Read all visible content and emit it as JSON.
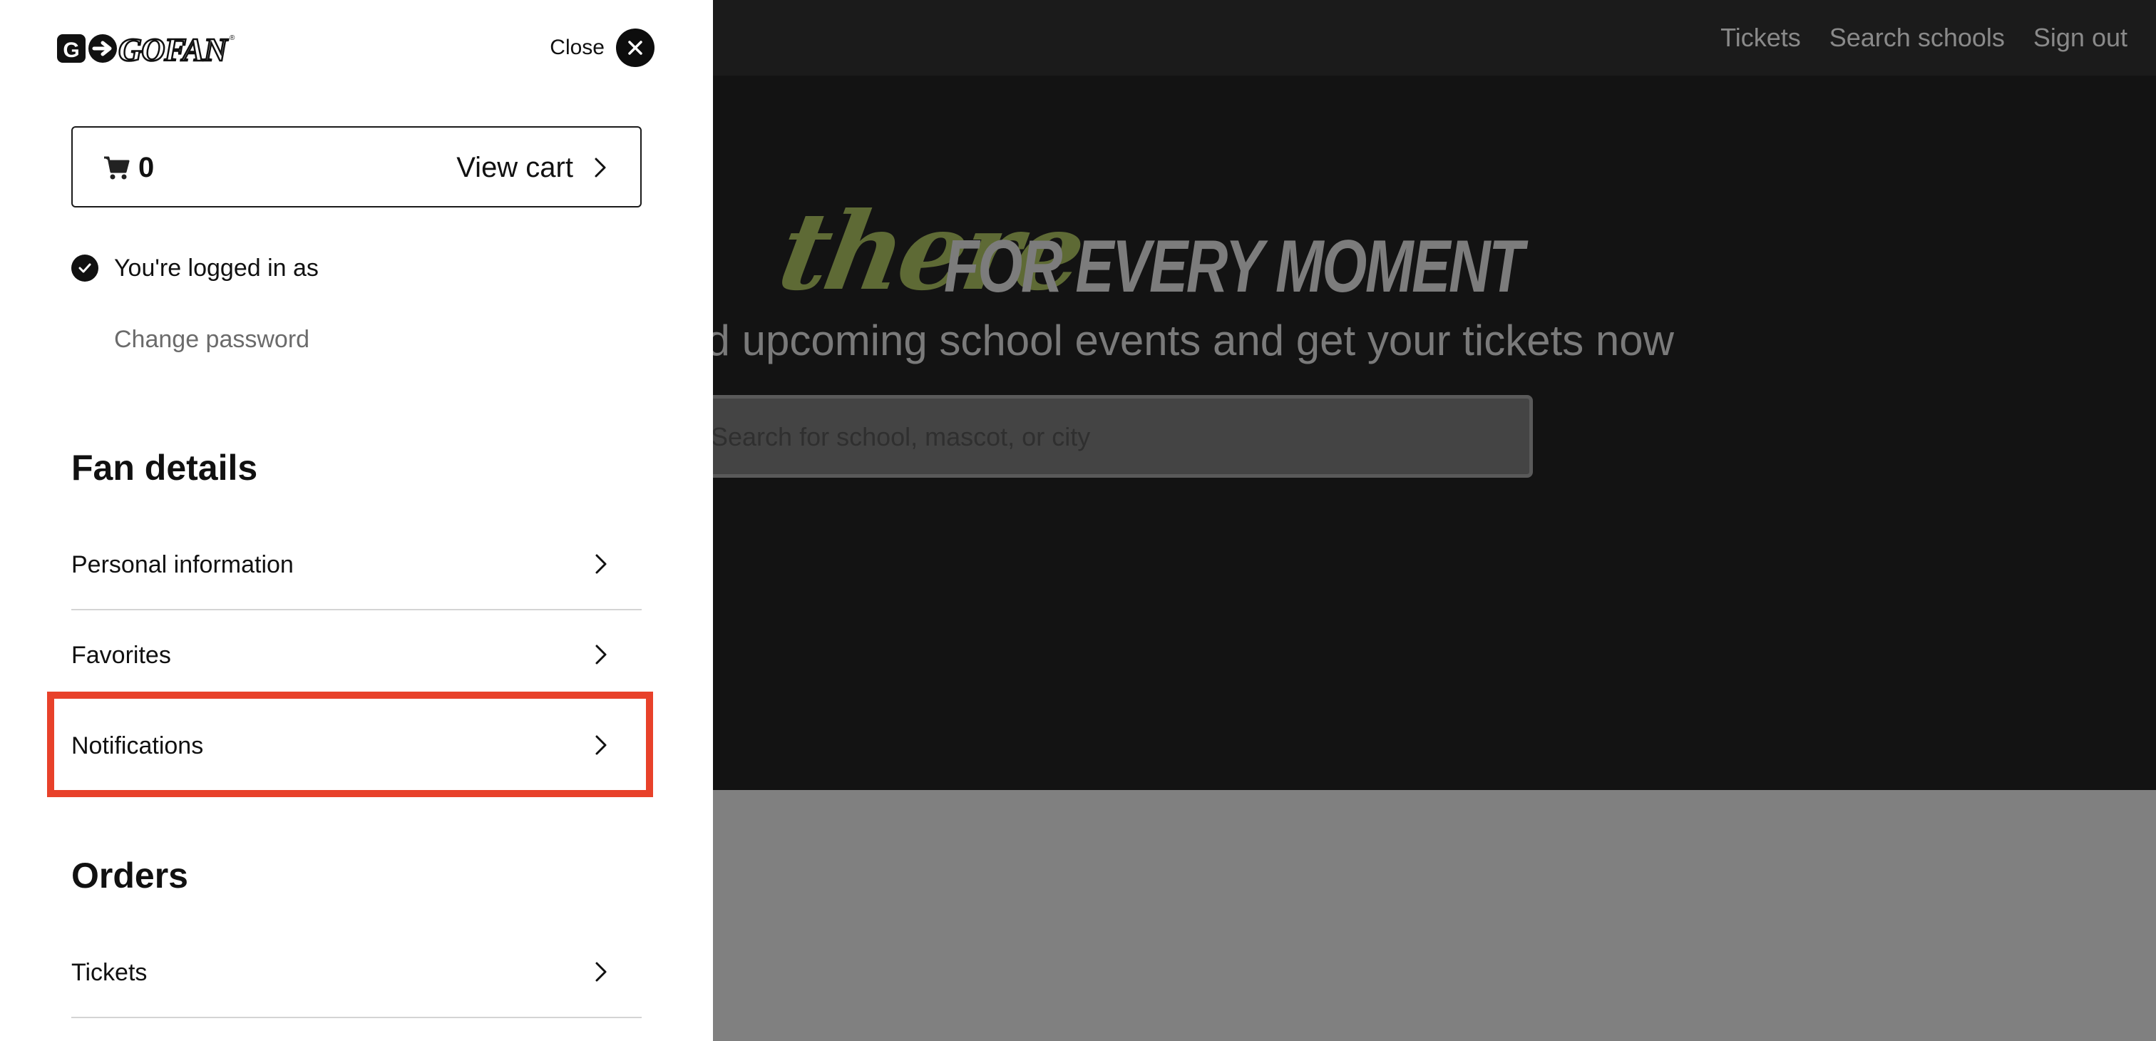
{
  "background": {
    "nav": [
      "Tickets",
      "Search schools",
      "Sign out"
    ],
    "slogan_script": "there",
    "slogan_bold": "FOR EVERY MOMENT",
    "hero_subtitle": "Find upcoming school events and get your tickets now",
    "search_placeholder": "Search for school, mascot, or city"
  },
  "drawer": {
    "logo_text": "GOFAN",
    "close_label": "Close",
    "cart": {
      "count": "0",
      "label": "View cart"
    },
    "logged_in_text": "You're logged in as",
    "change_password": "Change password",
    "sections": [
      {
        "title": "Fan details",
        "items": [
          "Personal information",
          "Favorites",
          "Notifications"
        ]
      },
      {
        "title": "Orders",
        "items": [
          "Tickets"
        ]
      }
    ],
    "highlighted_item": "Notifications"
  },
  "colors": {
    "highlight": "#e8412a",
    "slogan_script": "#5e6a35",
    "drawer_bg": "#ffffff",
    "page_bg": "#131313"
  }
}
